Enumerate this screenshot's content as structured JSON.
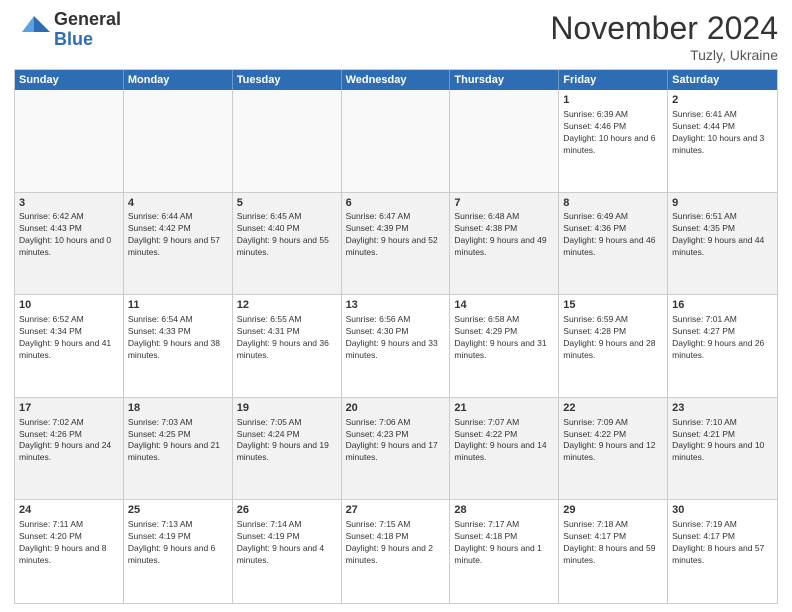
{
  "logo": {
    "general": "General",
    "blue": "Blue"
  },
  "header": {
    "title": "November 2024",
    "location": "Tuzly, Ukraine"
  },
  "weekdays": [
    "Sunday",
    "Monday",
    "Tuesday",
    "Wednesday",
    "Thursday",
    "Friday",
    "Saturday"
  ],
  "weeks": [
    [
      {
        "day": "",
        "info": "",
        "empty": true
      },
      {
        "day": "",
        "info": "",
        "empty": true
      },
      {
        "day": "",
        "info": "",
        "empty": true
      },
      {
        "day": "",
        "info": "",
        "empty": true
      },
      {
        "day": "",
        "info": "",
        "empty": true
      },
      {
        "day": "1",
        "info": "Sunrise: 6:39 AM\nSunset: 4:46 PM\nDaylight: 10 hours and 6 minutes.",
        "empty": false
      },
      {
        "day": "2",
        "info": "Sunrise: 6:41 AM\nSunset: 4:44 PM\nDaylight: 10 hours and 3 minutes.",
        "empty": false
      }
    ],
    [
      {
        "day": "3",
        "info": "Sunrise: 6:42 AM\nSunset: 4:43 PM\nDaylight: 10 hours and 0 minutes.",
        "empty": false
      },
      {
        "day": "4",
        "info": "Sunrise: 6:44 AM\nSunset: 4:42 PM\nDaylight: 9 hours and 57 minutes.",
        "empty": false
      },
      {
        "day": "5",
        "info": "Sunrise: 6:45 AM\nSunset: 4:40 PM\nDaylight: 9 hours and 55 minutes.",
        "empty": false
      },
      {
        "day": "6",
        "info": "Sunrise: 6:47 AM\nSunset: 4:39 PM\nDaylight: 9 hours and 52 minutes.",
        "empty": false
      },
      {
        "day": "7",
        "info": "Sunrise: 6:48 AM\nSunset: 4:38 PM\nDaylight: 9 hours and 49 minutes.",
        "empty": false
      },
      {
        "day": "8",
        "info": "Sunrise: 6:49 AM\nSunset: 4:36 PM\nDaylight: 9 hours and 46 minutes.",
        "empty": false
      },
      {
        "day": "9",
        "info": "Sunrise: 6:51 AM\nSunset: 4:35 PM\nDaylight: 9 hours and 44 minutes.",
        "empty": false
      }
    ],
    [
      {
        "day": "10",
        "info": "Sunrise: 6:52 AM\nSunset: 4:34 PM\nDaylight: 9 hours and 41 minutes.",
        "empty": false
      },
      {
        "day": "11",
        "info": "Sunrise: 6:54 AM\nSunset: 4:33 PM\nDaylight: 9 hours and 38 minutes.",
        "empty": false
      },
      {
        "day": "12",
        "info": "Sunrise: 6:55 AM\nSunset: 4:31 PM\nDaylight: 9 hours and 36 minutes.",
        "empty": false
      },
      {
        "day": "13",
        "info": "Sunrise: 6:56 AM\nSunset: 4:30 PM\nDaylight: 9 hours and 33 minutes.",
        "empty": false
      },
      {
        "day": "14",
        "info": "Sunrise: 6:58 AM\nSunset: 4:29 PM\nDaylight: 9 hours and 31 minutes.",
        "empty": false
      },
      {
        "day": "15",
        "info": "Sunrise: 6:59 AM\nSunset: 4:28 PM\nDaylight: 9 hours and 28 minutes.",
        "empty": false
      },
      {
        "day": "16",
        "info": "Sunrise: 7:01 AM\nSunset: 4:27 PM\nDaylight: 9 hours and 26 minutes.",
        "empty": false
      }
    ],
    [
      {
        "day": "17",
        "info": "Sunrise: 7:02 AM\nSunset: 4:26 PM\nDaylight: 9 hours and 24 minutes.",
        "empty": false
      },
      {
        "day": "18",
        "info": "Sunrise: 7:03 AM\nSunset: 4:25 PM\nDaylight: 9 hours and 21 minutes.",
        "empty": false
      },
      {
        "day": "19",
        "info": "Sunrise: 7:05 AM\nSunset: 4:24 PM\nDaylight: 9 hours and 19 minutes.",
        "empty": false
      },
      {
        "day": "20",
        "info": "Sunrise: 7:06 AM\nSunset: 4:23 PM\nDaylight: 9 hours and 17 minutes.",
        "empty": false
      },
      {
        "day": "21",
        "info": "Sunrise: 7:07 AM\nSunset: 4:22 PM\nDaylight: 9 hours and 14 minutes.",
        "empty": false
      },
      {
        "day": "22",
        "info": "Sunrise: 7:09 AM\nSunset: 4:22 PM\nDaylight: 9 hours and 12 minutes.",
        "empty": false
      },
      {
        "day": "23",
        "info": "Sunrise: 7:10 AM\nSunset: 4:21 PM\nDaylight: 9 hours and 10 minutes.",
        "empty": false
      }
    ],
    [
      {
        "day": "24",
        "info": "Sunrise: 7:11 AM\nSunset: 4:20 PM\nDaylight: 9 hours and 8 minutes.",
        "empty": false
      },
      {
        "day": "25",
        "info": "Sunrise: 7:13 AM\nSunset: 4:19 PM\nDaylight: 9 hours and 6 minutes.",
        "empty": false
      },
      {
        "day": "26",
        "info": "Sunrise: 7:14 AM\nSunset: 4:19 PM\nDaylight: 9 hours and 4 minutes.",
        "empty": false
      },
      {
        "day": "27",
        "info": "Sunrise: 7:15 AM\nSunset: 4:18 PM\nDaylight: 9 hours and 2 minutes.",
        "empty": false
      },
      {
        "day": "28",
        "info": "Sunrise: 7:17 AM\nSunset: 4:18 PM\nDaylight: 9 hours and 1 minute.",
        "empty": false
      },
      {
        "day": "29",
        "info": "Sunrise: 7:18 AM\nSunset: 4:17 PM\nDaylight: 8 hours and 59 minutes.",
        "empty": false
      },
      {
        "day": "30",
        "info": "Sunrise: 7:19 AM\nSunset: 4:17 PM\nDaylight: 8 hours and 57 minutes.",
        "empty": false
      }
    ]
  ]
}
